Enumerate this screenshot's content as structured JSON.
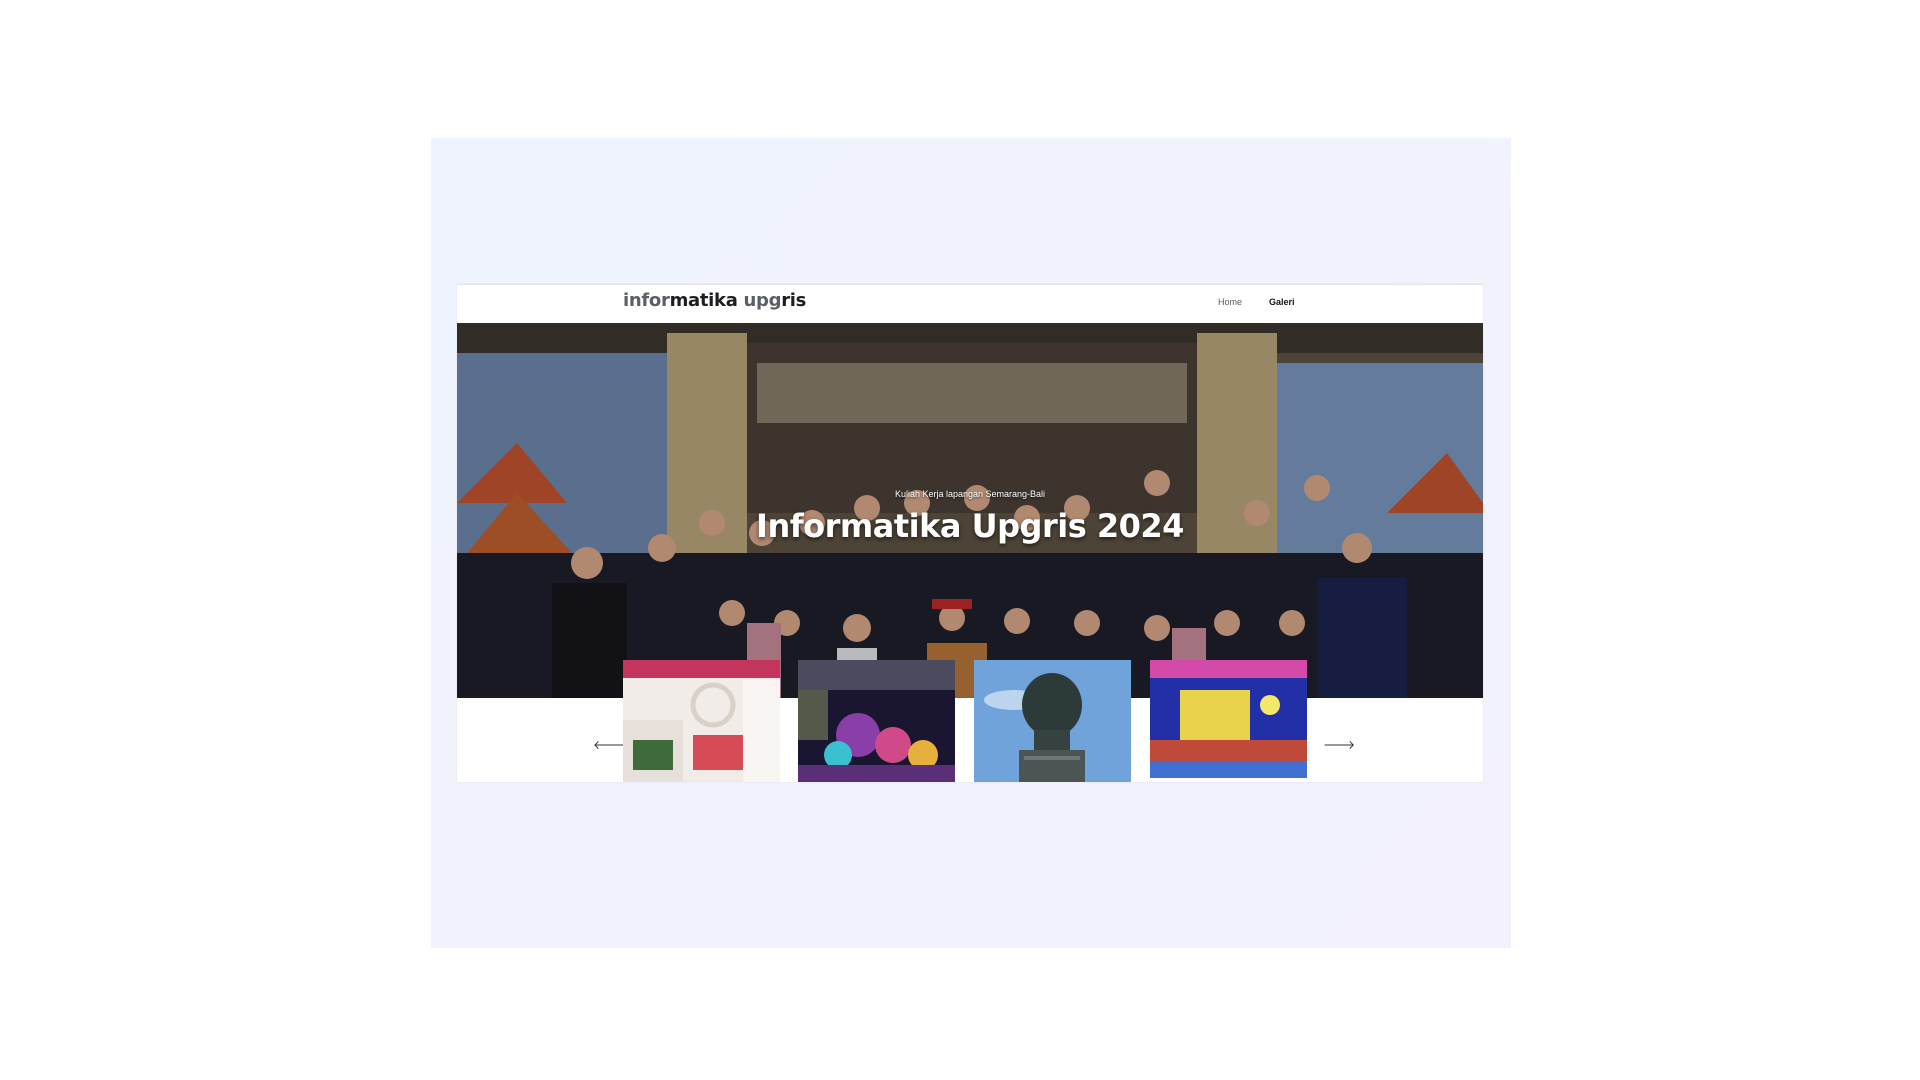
{
  "header": {
    "logo": {
      "light_1": "infor",
      "dark_1": "matika",
      "light_2": " upg",
      "dark_2": "ris"
    },
    "nav": {
      "home": "Home",
      "galeri": "Galeri"
    }
  },
  "hero": {
    "subtitle": "Kuliah Kerja lapangan Semarang-Bali",
    "title": "Informatika Upgris 2024"
  },
  "carousel": {
    "prev_icon": "arrow-left-icon",
    "next_icon": "arrow-right-icon",
    "prev_glyph": "🡐",
    "next_glyph": "🡒"
  },
  "colors": {
    "backdrop": "#eff2fc",
    "logo_light": "#5b5f66",
    "logo_dark": "#1c1e22",
    "hero_text": "#ffffff"
  }
}
